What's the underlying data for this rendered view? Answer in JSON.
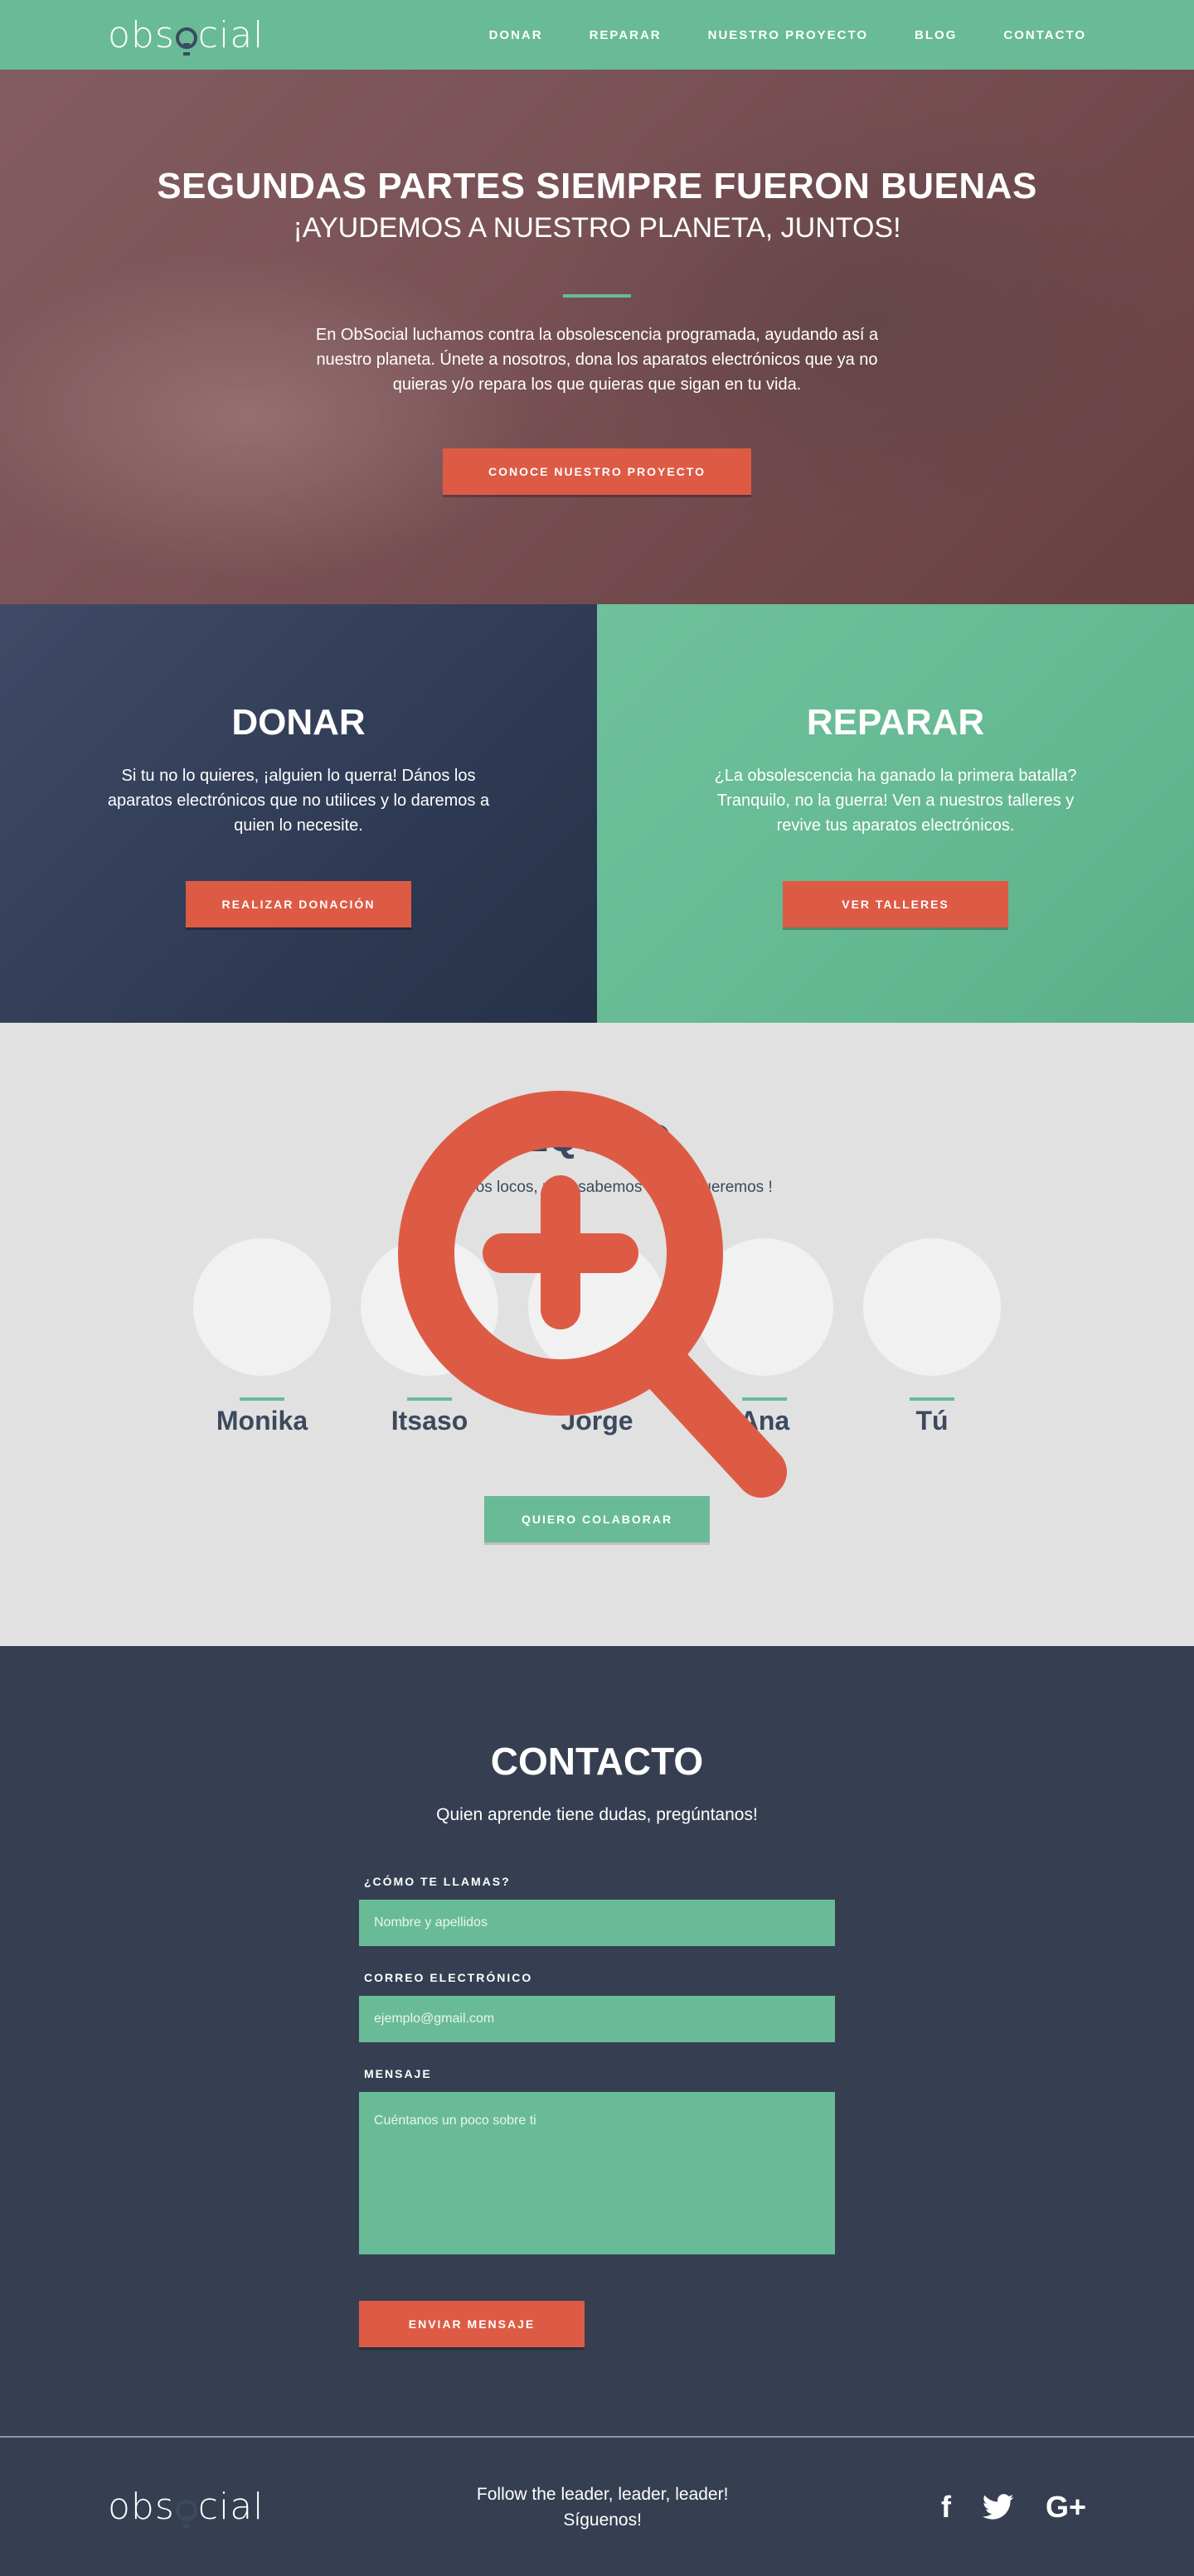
{
  "nav": {
    "logo": "obsocial",
    "links": [
      "DONAR",
      "REPARAR",
      "NUESTRO PROYECTO",
      "BLOG",
      "CONTACTO"
    ]
  },
  "hero": {
    "title": "SEGUNDAS PARTES SIEMPRE FUERON BUENAS",
    "subtitle": "¡AYUDEMOS A NUESTRO PLANETA, JUNTOS!",
    "text": "En ObSocial luchamos contra la obsolescencia programada, ayudando así a nuestro planeta.  Únete a nosotros, dona los aparatos electrónicos que ya no quieras y/o repara los que quieras que sigan en tu vida.",
    "cta": "CONOCE NUESTRO PROYECTO"
  },
  "donar": {
    "title": "DONAR",
    "text": "Si tu no lo quieres, ¡alguien lo querra! Dános los aparatos electrónicos que no utilices y lo daremos a quien lo necesite.",
    "cta": "REALIZAR DONACIÓN"
  },
  "reparar": {
    "title": "REPARAR",
    "text": "¿La obsolescencia ha ganado la primera batalla? Tranquilo, no la guerra! Ven a nuestros talleres y revive tus aparatos electrónicos.",
    "cta": "VER TALLERES"
  },
  "team": {
    "title": "EQUIPO",
    "subtitle": "No somos locos, pero sabemos lo que queremos !",
    "members": [
      "Monika",
      "Itsaso",
      "Jorge",
      "Ana",
      "Tú"
    ],
    "cta": "QUIERO COLABORAR"
  },
  "contact": {
    "title": "CONTACTO",
    "subtitle": "Quien aprende tiene dudas, pregúntanos!",
    "name_label": "¿CÓMO TE LLAMAS?",
    "name_placeholder": "Nombre y apellidos",
    "email_label": "CORREO ELECTRÓNICO",
    "email_placeholder": "ejemplo@gmail.com",
    "message_label": "MENSAJE",
    "message_placeholder": "Cuéntanos un poco sobre ti",
    "submit": "ENVIAR MENSAJE"
  },
  "footer": {
    "logo": "obsocial",
    "tagline_1": "Follow the leader, leader, leader!",
    "tagline_2": "Síguenos!",
    "social": [
      "f",
      "twitter",
      "G+"
    ]
  },
  "colors": {
    "green": "#69bb97",
    "red": "#dd5b45",
    "navy": "#363f51",
    "text_dark": "#3b4a5e"
  },
  "icons": [
    "zoom-in-magnifier-icon",
    "lightbulb-logo-icon",
    "facebook-icon",
    "twitter-icon",
    "google-plus-icon"
  ]
}
